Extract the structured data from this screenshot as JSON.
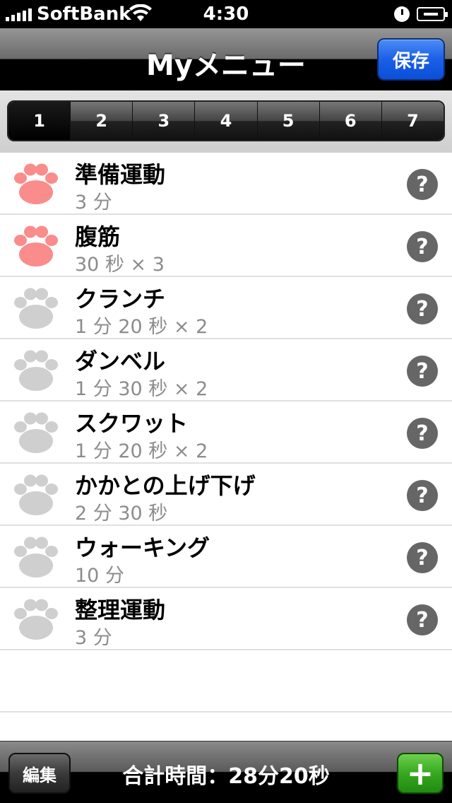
{
  "status_bar": {
    "carrier": "SoftBank",
    "time": "4:30"
  },
  "navbar": {
    "title": "Myメニュー",
    "save_label": "保存"
  },
  "segments": [
    "1",
    "2",
    "3",
    "4",
    "5",
    "6",
    "7"
  ],
  "selected_segment": "1",
  "items": [
    {
      "title": "準備運動",
      "subtitle": "3 分",
      "done": true
    },
    {
      "title": "腹筋",
      "subtitle": "30 秒 × 3",
      "done": true
    },
    {
      "title": "クランチ",
      "subtitle": "1 分 20 秒 × 2",
      "done": false
    },
    {
      "title": "ダンベル",
      "subtitle": "1 分 30 秒 × 2",
      "done": false
    },
    {
      "title": "スクワット",
      "subtitle": "1 分 20 秒 × 2",
      "done": false
    },
    {
      "title": "かかとの上げ下げ",
      "subtitle": "2 分 30 秒",
      "done": false
    },
    {
      "title": "ウォーキング",
      "subtitle": "10 分",
      "done": false
    },
    {
      "title": "整理運動",
      "subtitle": "3 分",
      "done": false
    }
  ],
  "colors": {
    "paw_done": "#fa8c8c",
    "paw_pending": "#cfcfcf"
  },
  "toolbar": {
    "edit_label": "編集",
    "total_time": "合計時間：28分20秒",
    "add_label": "+"
  }
}
